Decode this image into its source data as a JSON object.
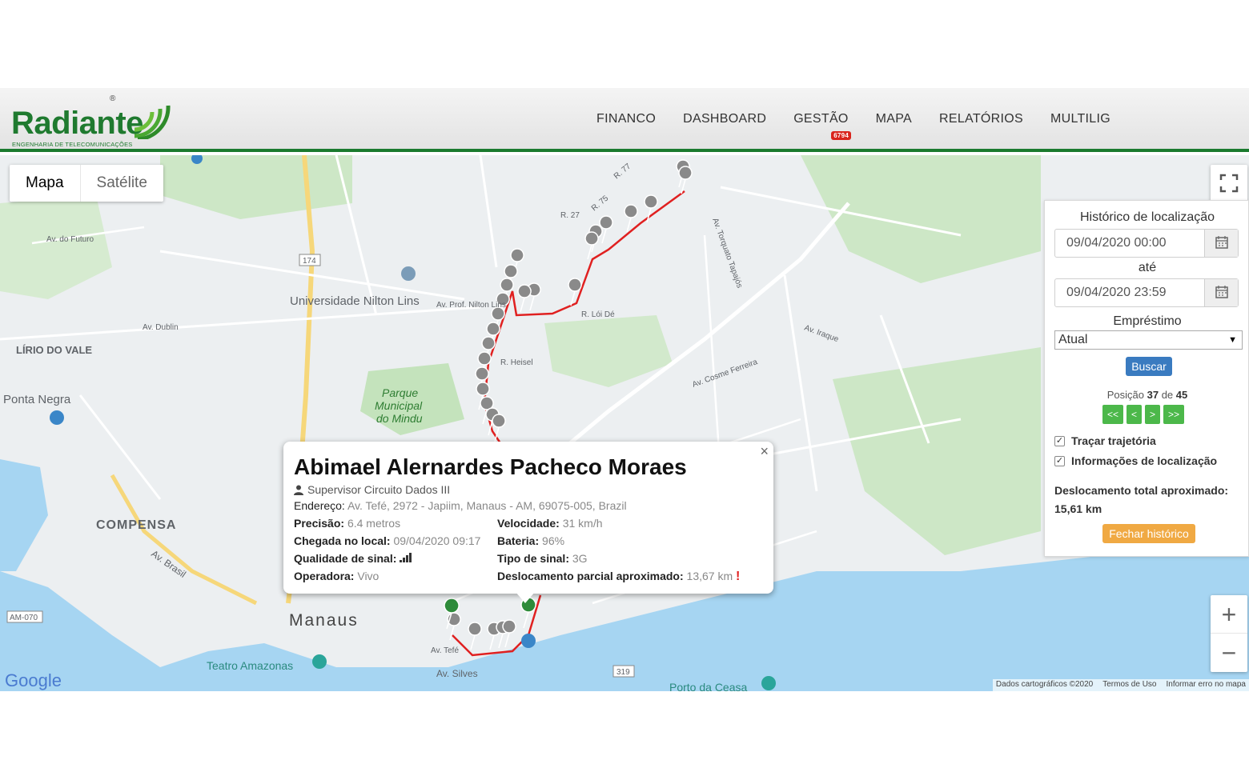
{
  "brand": {
    "name": "Radiante",
    "tagline": "ENGENHARIA DE TELECOMUNICAÇÕES",
    "registered": "®",
    "color": "#1f7a2f"
  },
  "nav": {
    "items": [
      "FINANCO",
      "DASHBOARD",
      "GESTÃO",
      "MAPA",
      "RELATÓRIOS",
      "MULTILIG"
    ],
    "badge": "6794"
  },
  "map": {
    "type_buttons": [
      "Mapa",
      "Satélite"
    ],
    "labels": [
      "Universidade Nilton Lins",
      "LÍRIO DO VALE",
      "Ponta Negra",
      "Parque",
      "Municipal",
      "do Mindu",
      "COMPENSA",
      "Manaus",
      "Teatro Amazonas",
      "Porto da Ceasa",
      "Av. Brasil",
      "Av. Silves",
      "R. Heisel",
      "R. Lói Dé",
      "Av. Prof. Nilton Lins",
      "R. 27",
      "R. 75",
      "R. 77",
      "Av. do Futuro",
      "Av. Dublin",
      "Av. Torquato Tapajós",
      "Av. Cosme Ferreira",
      "Av. Iraque",
      "Av. Tefé",
      "AM-070",
      "319",
      "174"
    ],
    "google": "Google",
    "attribution": [
      "Dados cartográficos ©2020",
      "Termos de Uso",
      "Informar erro no mapa"
    ],
    "zoom_in": "+",
    "zoom_out": "−"
  },
  "panel": {
    "title": "Histórico de localização",
    "date_from": "09/04/2020 00:00",
    "until_label": "até",
    "date_to": "09/04/2020 23:59",
    "loan_label": "Empréstimo",
    "loan_selected": "Atual",
    "search_button": "Buscar",
    "position_prefix": "Posição",
    "position_current": "37",
    "position_of": "de",
    "position_total": "45",
    "nav_buttons": [
      "<<",
      "<",
      ">",
      ">>"
    ],
    "checkbox_trajectory": "Traçar trajetória",
    "checkbox_info": "Informações de localização",
    "total_distance_label": "Deslocamento total aproximado:",
    "total_distance_value": "15,61 km",
    "close_button": "Fechar histórico"
  },
  "info": {
    "close": "×",
    "name": "Abimael Alernardes Pacheco Moraes",
    "role": "Supervisor Circuito Dados III",
    "address_label": "Endereço:",
    "address": "Av. Tefé, 2972 - Japiim, Manaus - AM, 69075-005, Brazil",
    "precision_label": "Precisão:",
    "precision": "6.4 metros",
    "speed_label": "Velocidade:",
    "speed": "31 km/h",
    "arrival_label": "Chegada no local:",
    "arrival": "09/04/2020 09:17",
    "battery_label": "Bateria:",
    "battery": "96%",
    "signal_quality_label": "Qualidade de sinal:",
    "signal_type_label": "Tipo de sinal:",
    "signal_type": "3G",
    "operator_label": "Operadora:",
    "operator": "Vivo",
    "partial_distance_label": "Deslocamento parcial aproximado:",
    "partial_distance": "13,67 km",
    "alert": "!"
  },
  "colors": {
    "route": "#e02020",
    "pin_gray": "#8a8a8a",
    "pin_green": "#2e8b3a",
    "water": "#9fd2f0",
    "park": "#c8e6c0"
  }
}
